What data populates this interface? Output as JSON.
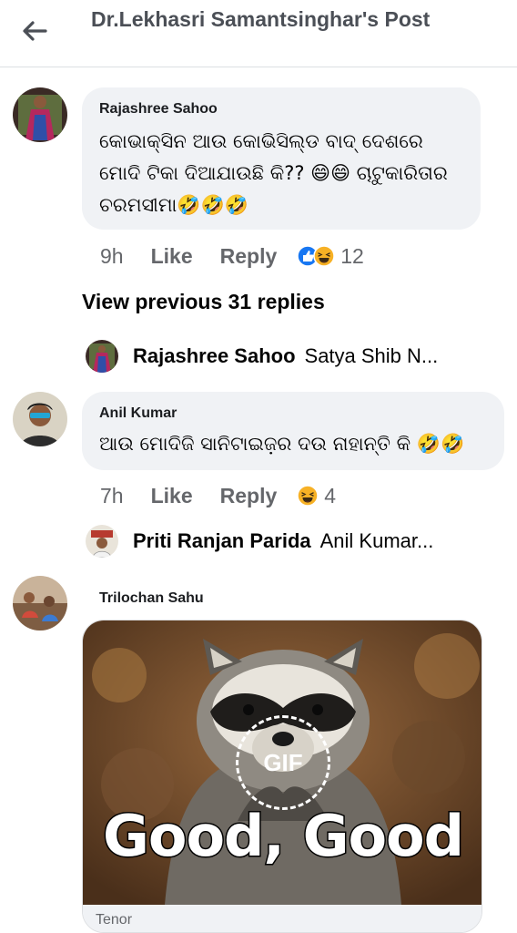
{
  "header": {
    "title": "Dr.Lekhasri Samantsinghar's Post",
    "back_icon": "back-arrow-icon"
  },
  "comments": [
    {
      "author": "Rajashree Sahoo",
      "text": "କୋଭାକ୍ସିନ ଆଉ କୋଭିସିଲ୍ଡ ବାଦ୍ ଦେଶରେ ମୋଦି ଟିକା ଦିଆଯାଉଛି କି?? 😄😄 ଚାଟୁକାରିତାର ଚରମସୀମା🤣🤣🤣",
      "time": "9h",
      "like_label": "Like",
      "reply_label": "Reply",
      "reactions": [
        "like-reaction-icon",
        "haha-reaction-icon"
      ],
      "reaction_count": "12"
    },
    {
      "author": "Anil Kumar",
      "text": "ଆଉ ମୋଦିଜି ସାନିଟାଇଜ଼ର ଦଉ ନାହାନ୍ତି କି 🤣🤣",
      "time": "7h",
      "like_label": "Like",
      "reply_label": "Reply",
      "reactions": [
        "haha-reaction-icon"
      ],
      "reaction_count": "4"
    },
    {
      "author": "Trilochan Sahu",
      "gif_badge": "GIF",
      "gif_caption": "Good, Good",
      "gif_source": "Tenor"
    }
  ],
  "view_previous": "View previous 31 replies",
  "replies": [
    {
      "name": "Rajashree Sahoo",
      "snippet": "Satya Shib N..."
    },
    {
      "name": "Priti Ranjan Parida",
      "snippet": "Anil Kumar..."
    }
  ],
  "colors": {
    "bubble": "#f0f2f5",
    "meta_text": "#65676b",
    "header_text": "#4b4f56",
    "like_blue": "#1877f2",
    "haha_yellow": "#f7b125"
  }
}
